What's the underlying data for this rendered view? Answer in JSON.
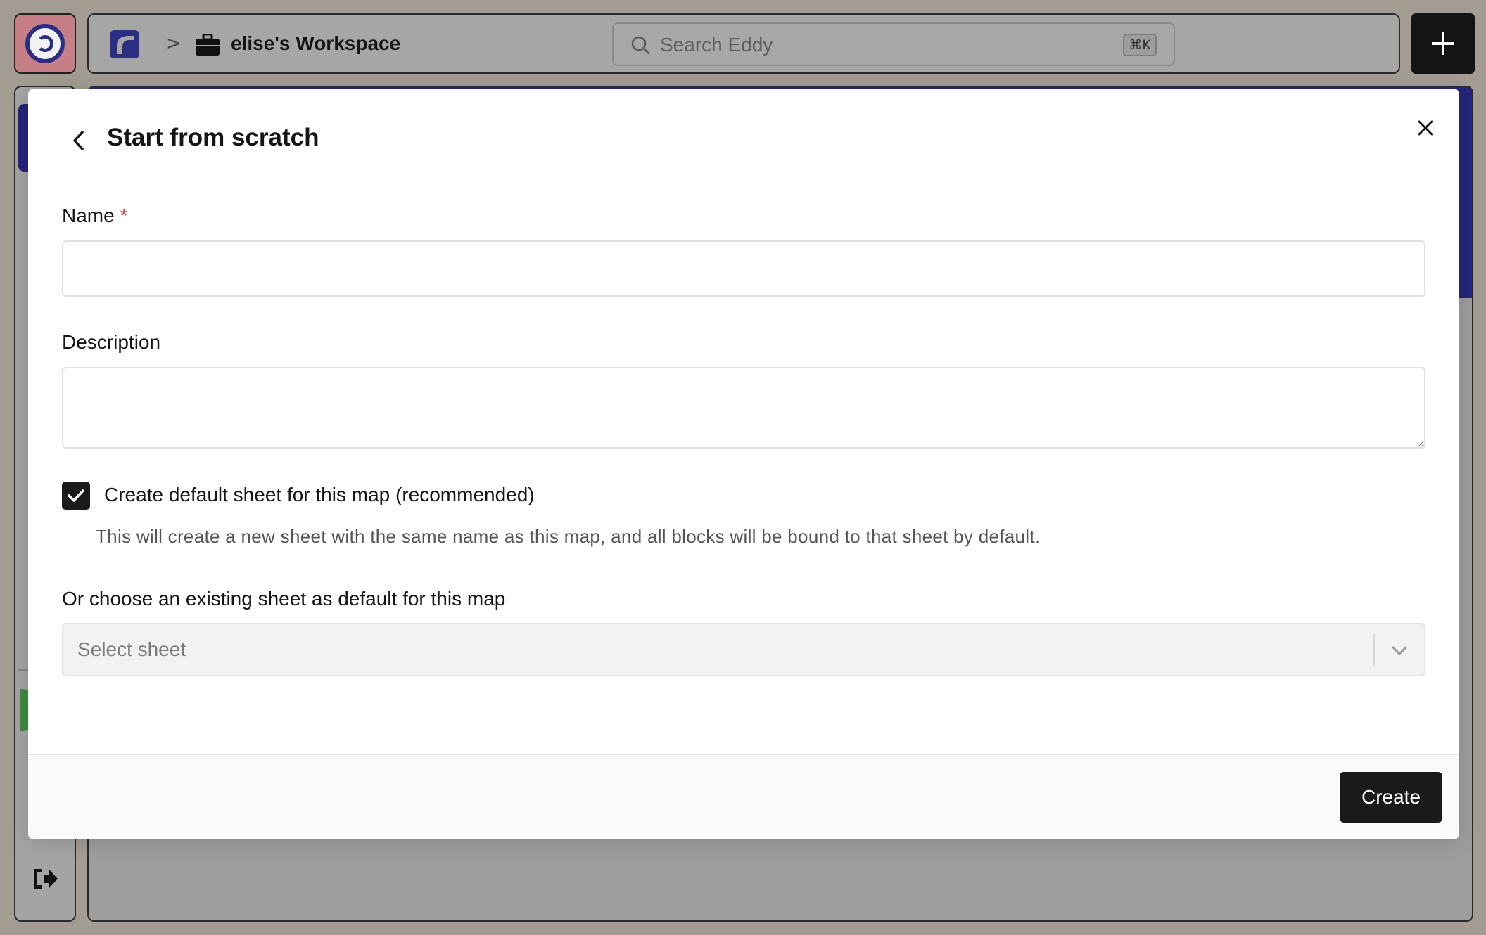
{
  "topbar": {
    "workspace_name": "elise's Workspace",
    "breadcrumb_separator": ">",
    "search": {
      "placeholder": "Search Eddy",
      "shortcut": "⌘K"
    },
    "plus_icon": "plus-icon"
  },
  "modal": {
    "title": "Start from scratch",
    "name_field": {
      "label": "Name",
      "required_marker": "*",
      "value": ""
    },
    "description_field": {
      "label": "Description",
      "value": ""
    },
    "default_sheet_checkbox": {
      "label": "Create default sheet for this map (recommended)",
      "checked": true,
      "help": "This will create a new sheet with the same name as this map, and all blocks will be bound to that sheet by default."
    },
    "existing_sheet": {
      "label": "Or choose an existing sheet as default for this map",
      "placeholder": "Select sheet"
    },
    "create_label": "Create"
  },
  "colors": {
    "accent": "#25267c",
    "primary_button": "#1a1a1a",
    "required": "#d23b3b"
  }
}
